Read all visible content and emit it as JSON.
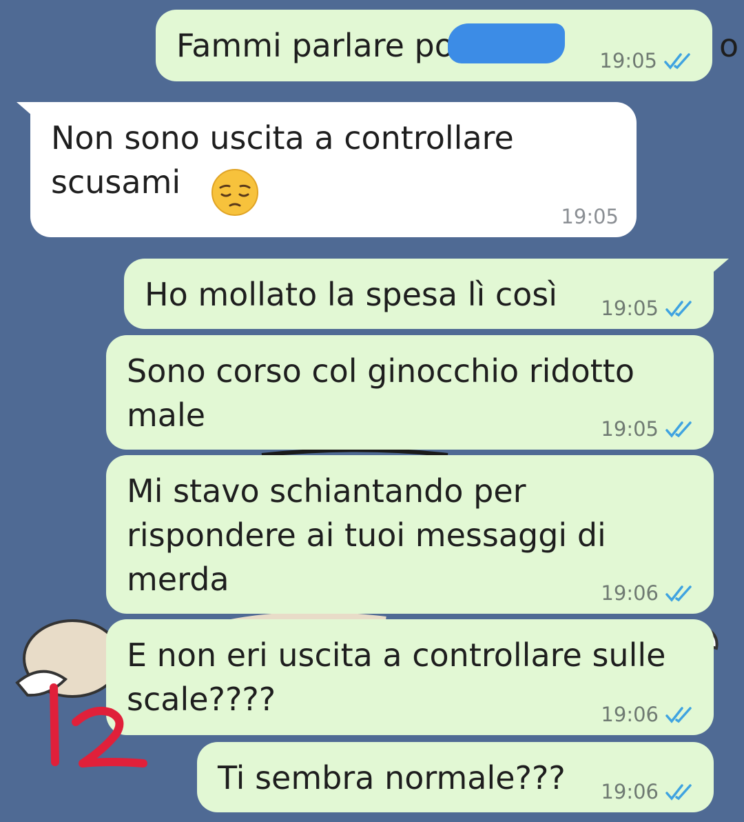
{
  "messages": [
    {
      "id": "m1",
      "side": "out",
      "text": "Fammi parlare po",
      "text_tail": "o",
      "time": "19:05",
      "status": "read"
    },
    {
      "id": "m2",
      "side": "in",
      "text": "Non sono uscita a controllare\nscusami",
      "emoji": "pensive-face",
      "time": "19:05"
    },
    {
      "id": "m3",
      "side": "out",
      "text": "Ho mollato la spesa lì così",
      "time": "19:05",
      "status": "read"
    },
    {
      "id": "m4",
      "side": "out",
      "text": "Sono corso col ginocchio ridotto\nmale",
      "time": "19:05",
      "status": "read"
    },
    {
      "id": "m5",
      "side": "out",
      "text": "Mi stavo schiantando per\nrispondere ai tuoi messaggi di\nmerda",
      "time": "19:06",
      "status": "read"
    },
    {
      "id": "m6",
      "side": "out",
      "text": "E non eri uscita a controllare sulle\nscale????",
      "time": "19:06",
      "status": "read"
    },
    {
      "id": "m7",
      "side": "out",
      "text": "Ti sembra normale???",
      "time": "19:06",
      "status": "read"
    }
  ],
  "annotation": "12",
  "colors": {
    "background": "#4f6a94",
    "outgoing_bubble": "#e2f8d4",
    "incoming_bubble": "#ffffff",
    "read_ticks": "#3fa3e0",
    "redaction": "#3c8ce6",
    "annotation_ink": "#e0203a"
  },
  "icons": {
    "read_receipt": "double-check-icon",
    "emoji": "pensive-face-emoji"
  }
}
